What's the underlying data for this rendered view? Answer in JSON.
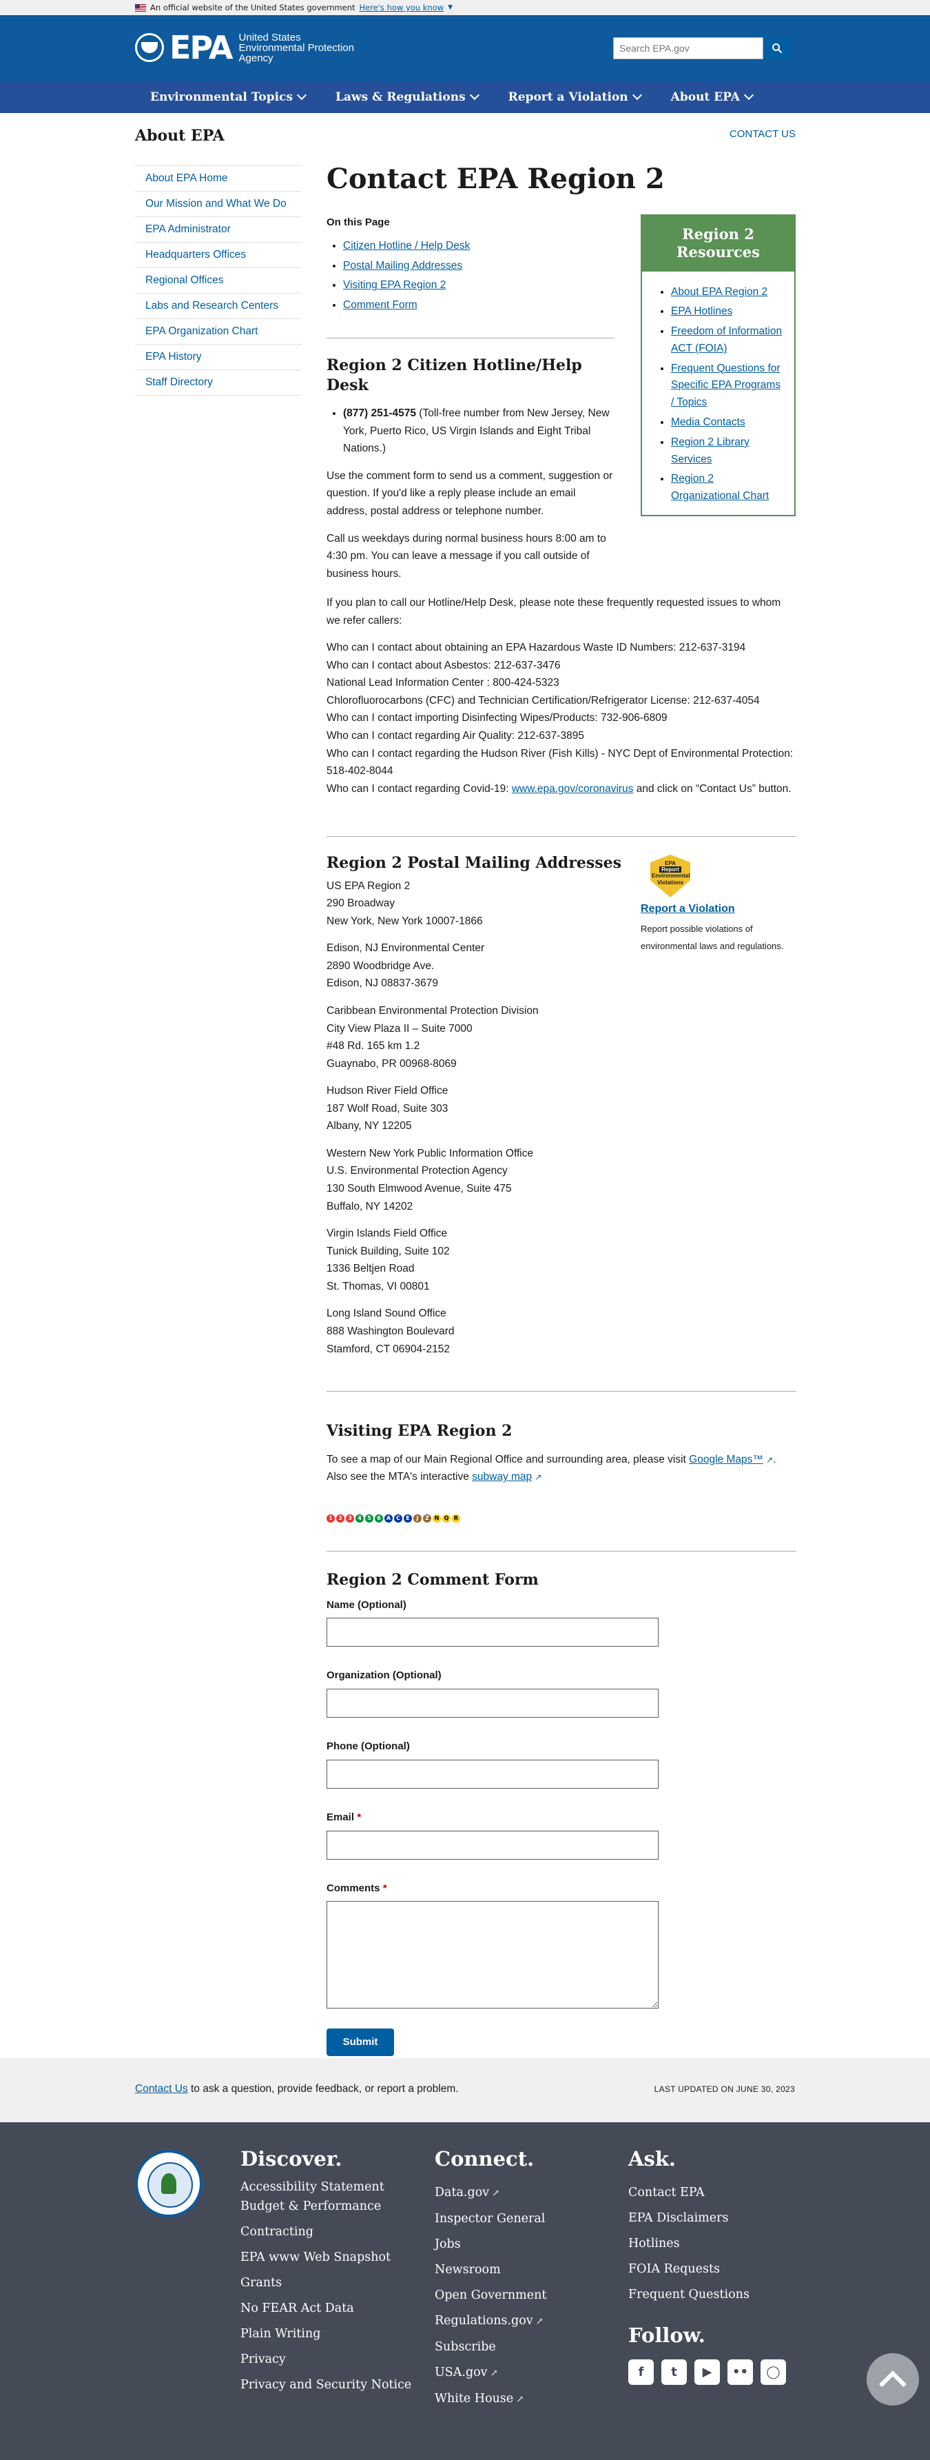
{
  "banner": {
    "text": "An official website of the United States government",
    "link": "Here's how you know"
  },
  "header": {
    "logo_text": "EPA",
    "agency_line1": "United States",
    "agency_line2": "Environmental Protection",
    "agency_line3": "Agency",
    "search_placeholder": "Search EPA.gov"
  },
  "nav": [
    "Environmental Topics",
    "Laws & Regulations",
    "Report a Violation",
    "About EPA"
  ],
  "about_title": "About EPA",
  "contact_us_top": "CONTACT US",
  "sidebar": [
    "About EPA Home",
    "Our Mission and What We Do",
    "EPA Administrator",
    "Headquarters Offices",
    "Regional Offices",
    "Labs and Research Centers",
    "EPA Organization Chart",
    "EPA History",
    "Staff Directory"
  ],
  "page_title": "Contact EPA Region 2",
  "on_this_page": {
    "heading": "On this Page",
    "links": [
      "Citizen Hotline / Help Desk",
      "Postal Mailing Addresses",
      "Visiting EPA Region 2",
      "Comment Form"
    ]
  },
  "resources": {
    "title": "Region 2 Resources",
    "links": [
      "About EPA Region 2",
      "EPA Hotlines",
      "Freedom of Information ACT (FOIA)",
      "Frequent Questions for Specific EPA Programs / Topics",
      "Media Contacts",
      "Region 2 Library Services",
      "Region 2 Organizational Chart"
    ]
  },
  "hotline": {
    "heading": "Region 2 Citizen Hotline/Help Desk",
    "phone": "(877) 251-4575",
    "phone_note": " (Toll-free number from New Jersey, New York, Puerto Rico, US Virgin Islands and Eight Tribal Nations.)",
    "p1": "Use the comment form to send us a comment, suggestion or question.  If you'd like a reply please include an email address, postal address or telephone number.",
    "p2": "Call us weekdays during normal business hours 8:00 am to 4:30 pm.  You can leave a message if you call outside of business hours.",
    "p3": "If you plan to call our Hotline/Help Desk, please note these frequently requested issues to whom we refer callers:",
    "lines": [
      "Who can I contact about obtaining an EPA Hazardous Waste ID Numbers: 212-637-3194",
      "Who can I contact about Asbestos: 212-637-3476",
      "National Lead Information Center : 800-424-5323",
      "Chlorofluorocarbons (CFC) and Technician Certification/Refrigerator License: 212-637-4054",
      "Who can I contact importing Disinfecting Wipes/Products: 732-906-6809",
      "Who can I contact regarding Air Quality: 212-637-3895",
      "Who can I contact regarding the Hudson River (Fish Kills) - NYC Dept of Environmental Protection: 518-402-8044"
    ],
    "covid_pre": "Who can I contact regarding Covid-19: ",
    "covid_link": "www.epa.gov/coronavirus",
    "covid_post": " and click on “Contact Us” button."
  },
  "postal": {
    "heading": "Region 2 Postal Mailing Addresses",
    "addresses": [
      [
        "US EPA Region 2",
        "290 Broadway",
        "New York, New York 10007-1866"
      ],
      [
        "Edison, NJ Environmental Center",
        "2890 Woodbridge Ave.",
        "Edison, NJ 08837-3679"
      ],
      [
        "Caribbean Environmental Protection Division",
        "City View Plaza II – Suite 7000",
        "#48 Rd. 165 km 1.2",
        "Guaynabo, PR 00968-8069"
      ],
      [
        "Hudson River Field Office",
        "187 Wolf Road, Suite 303",
        "Albany, NY 12205"
      ],
      [
        "Western New York Public Information Office",
        "U.S. Environmental Protection Agency",
        "130 South Elmwood Avenue, Suite 475",
        "Buffalo, NY 14202"
      ],
      [
        "Virgin Islands Field Office",
        "Tunick Building, Suite 102",
        "1336 Beltjen Road",
        "St. Thomas, VI 00801"
      ],
      [
        "Long Island Sound Office",
        "888 Washington Boulevard",
        "Stamford, CT 06904-2152"
      ]
    ]
  },
  "violation": {
    "badge_top": "EPA",
    "badge_mid": "Report",
    "badge_bot": "Environmental Violations",
    "link": "Report a Violation",
    "desc": "Report possible violations of environmental laws and regulations."
  },
  "visiting": {
    "heading": "Visiting EPA Region 2",
    "pre": "To see a map of our Main Regional Office and surrounding area, please visit ",
    "maps_link": "Google Maps™",
    "mid": ". Also see the MTA's interactive ",
    "subway_link": "subway map"
  },
  "subway_lines": [
    {
      "label": "1",
      "color": "#ee352e"
    },
    {
      "label": "2",
      "color": "#ee352e"
    },
    {
      "label": "3",
      "color": "#ee352e"
    },
    {
      "label": "4",
      "color": "#00933c"
    },
    {
      "label": "5",
      "color": "#00933c"
    },
    {
      "label": "6",
      "color": "#00933c"
    },
    {
      "label": "A",
      "color": "#0039a6"
    },
    {
      "label": "C",
      "color": "#0039a6"
    },
    {
      "label": "E",
      "color": "#0039a6"
    },
    {
      "label": "J",
      "color": "#996633"
    },
    {
      "label": "Z",
      "color": "#996633"
    },
    {
      "label": "N",
      "color": "#fccc0a"
    },
    {
      "label": "Q",
      "color": "#fccc0a"
    },
    {
      "label": "R",
      "color": "#fccc0a"
    }
  ],
  "form": {
    "heading": "Region 2 Comment Form",
    "name": "Name (Optional)",
    "org": "Organization (Optional)",
    "phone": "Phone (Optional)",
    "email": "Email",
    "comments": "Comments",
    "required_mark": "*",
    "submit": "Submit"
  },
  "last": {
    "contact_link": "Contact Us",
    "contact_text": " to ask a question, provide feedback, or report a problem.",
    "updated": "LAST UPDATED ON JUNE 30, 2023"
  },
  "footer": {
    "discover": {
      "title": "Discover.",
      "links": [
        "Accessibility Statement",
        "Budget & Performance",
        "Contracting",
        "EPA www Web Snapshot",
        "Grants",
        "No FEAR Act Data",
        "Plain Writing",
        "Privacy",
        "Privacy and Security Notice"
      ]
    },
    "connect": {
      "title": "Connect.",
      "links": [
        "Data.gov",
        "Inspector General",
        "Jobs",
        "Newsroom",
        "Open Government",
        "Regulations.gov",
        "Subscribe",
        "USA.gov",
        "White House"
      ]
    },
    "ask": {
      "title": "Ask.",
      "links": [
        "Contact EPA",
        "EPA Disclaimers",
        "Hotlines",
        "FOIA Requests",
        "Frequent Questions"
      ]
    },
    "follow": {
      "title": "Follow."
    }
  }
}
